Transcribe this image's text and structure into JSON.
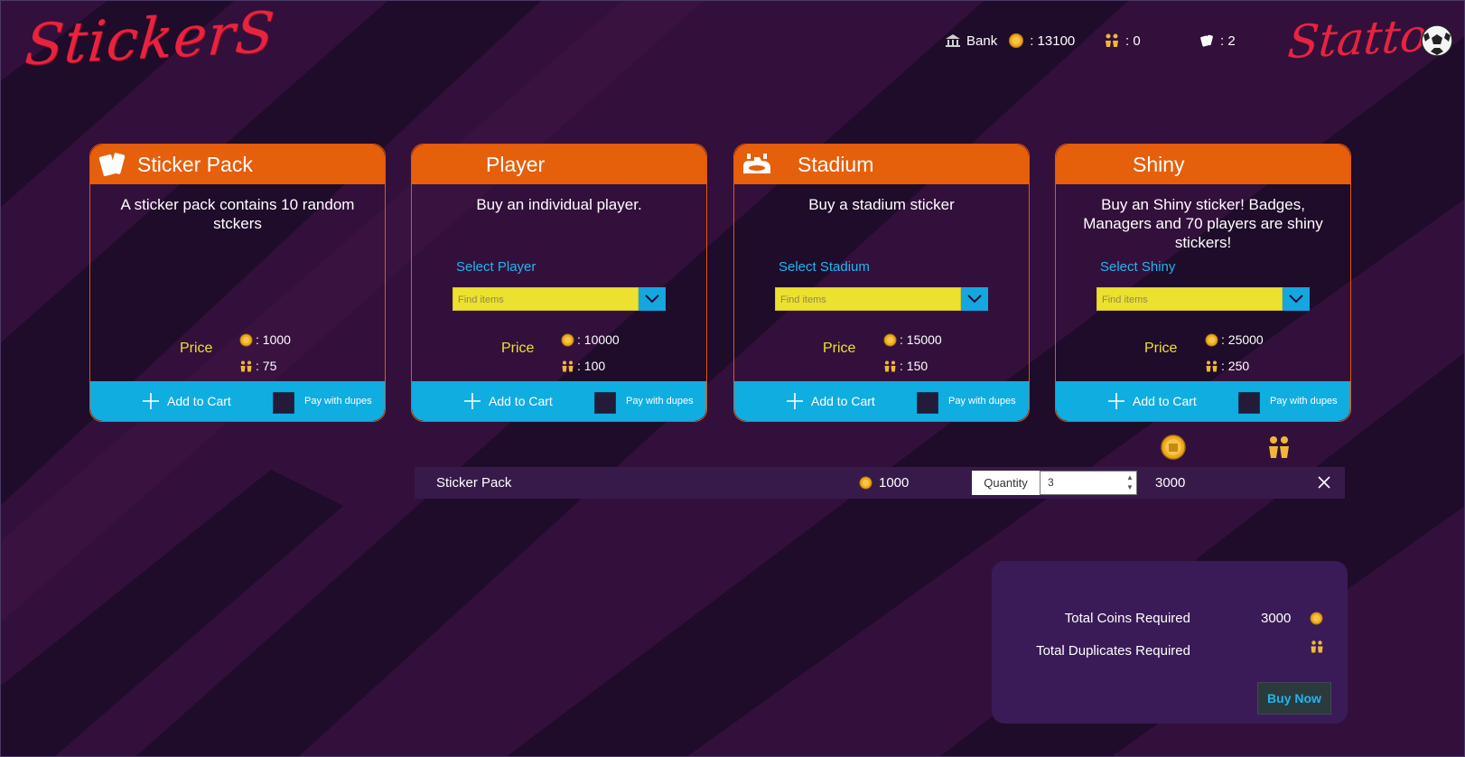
{
  "app": {
    "logo_left": "StickerS",
    "logo_right": "Statto"
  },
  "topbar": {
    "bank_label": "Bank",
    "coins": ": 13100",
    "duplicates": ": 0",
    "packs": ": 2"
  },
  "cards": [
    {
      "title": "Sticker Pack",
      "description": "A sticker pack contains 10 random stckers",
      "price_label": "Price",
      "price_coins": ": 1000",
      "price_dupes": ": 75",
      "add_label": "Add to Cart",
      "dupes_label": "Pay with dupes"
    },
    {
      "title": "Player",
      "description": "Buy an individual player.",
      "select_label": "Select Player",
      "select_placeholder": "Find items",
      "price_label": "Price",
      "price_coins": ": 10000",
      "price_dupes": ": 100",
      "add_label": "Add to Cart",
      "dupes_label": "Pay with dupes"
    },
    {
      "title": "Stadium",
      "description": "Buy a stadium sticker",
      "select_label": "Select Stadium",
      "select_placeholder": "Find items",
      "price_label": "Price",
      "price_coins": ": 15000",
      "price_dupes": ": 150",
      "add_label": "Add to Cart",
      "dupes_label": "Pay with dupes"
    },
    {
      "title": "Shiny",
      "description": "Buy an Shiny sticker! Badges, Managers and 70 players are shiny stickers!",
      "select_label": "Select Shiny",
      "select_placeholder": "Find items",
      "price_label": "Price",
      "price_coins": ": 25000",
      "price_dupes": ": 250",
      "add_label": "Add to Cart",
      "dupes_label": "Pay with dupes"
    }
  ],
  "cart": {
    "items": [
      {
        "name": "Sticker Pack",
        "unit_price": "1000",
        "quantity_label": "Quantity",
        "quantity": "3",
        "total": "3000"
      }
    ]
  },
  "summary": {
    "coins_label": "Total Coins Required",
    "coins_value": "3000",
    "dupes_label": "Total Duplicates Required",
    "buy_label": "Buy Now"
  },
  "colors": {
    "accent_orange": "#e65f0b",
    "accent_blue": "#10ade1",
    "select_yellow": "#ece12f",
    "price_yellow": "#ece12f",
    "logo_red": "#e8233f"
  },
  "icons": {
    "bank": "bank-icon",
    "coin": "coin-icon",
    "duplicates": "duplicates-icon",
    "packs": "card-pack-icon",
    "stadium": "stadium-icon",
    "ball": "football-icon",
    "plus": "plus-icon",
    "chevron": "chevron-down-icon",
    "close": "close-icon"
  }
}
